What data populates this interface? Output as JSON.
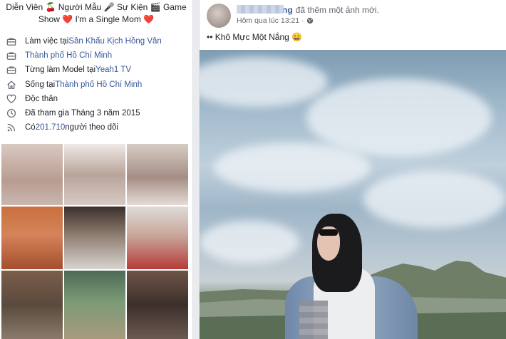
{
  "bio": {
    "line1": "Diễn Viên 🍒 Người Mẫu 🎤 Sự Kiện 🎬 Game",
    "line2": "Show ❤️ I'm a Single Mom ❤️"
  },
  "intro": [
    {
      "icon": "briefcase-icon",
      "prefix": "Làm việc tại ",
      "link": "Sân Khấu Kịch Hồng Vân",
      "suffix": ""
    },
    {
      "icon": "briefcase-icon",
      "prefix": "",
      "link": "Thành phố Hồ Chí Minh",
      "suffix": ""
    },
    {
      "icon": "briefcase-icon",
      "prefix": "Từng làm Model tại ",
      "link": "Yeah1 TV",
      "suffix": ""
    },
    {
      "icon": "home-icon",
      "prefix": "Sống tại ",
      "link": "Thành phố Hồ Chí Minh",
      "suffix": ""
    },
    {
      "icon": "heart-icon",
      "prefix": "Độc thân",
      "link": "",
      "suffix": ""
    },
    {
      "icon": "clock-icon",
      "prefix": "Đã tham gia Tháng 3 năm 2015",
      "link": "",
      "suffix": ""
    },
    {
      "icon": "rss-icon",
      "prefix": "Có ",
      "link": "201.710",
      "suffix": " người theo dõi"
    }
  ],
  "post": {
    "author_visible": "ng",
    "action": "đã thêm một ảnh mới.",
    "time": "Hôm qua lúc 13:21",
    "caption": "•• Khô Mực Một Nắng 😄"
  },
  "colors": {
    "link": "#365899",
    "secondary_text": "#606770"
  }
}
